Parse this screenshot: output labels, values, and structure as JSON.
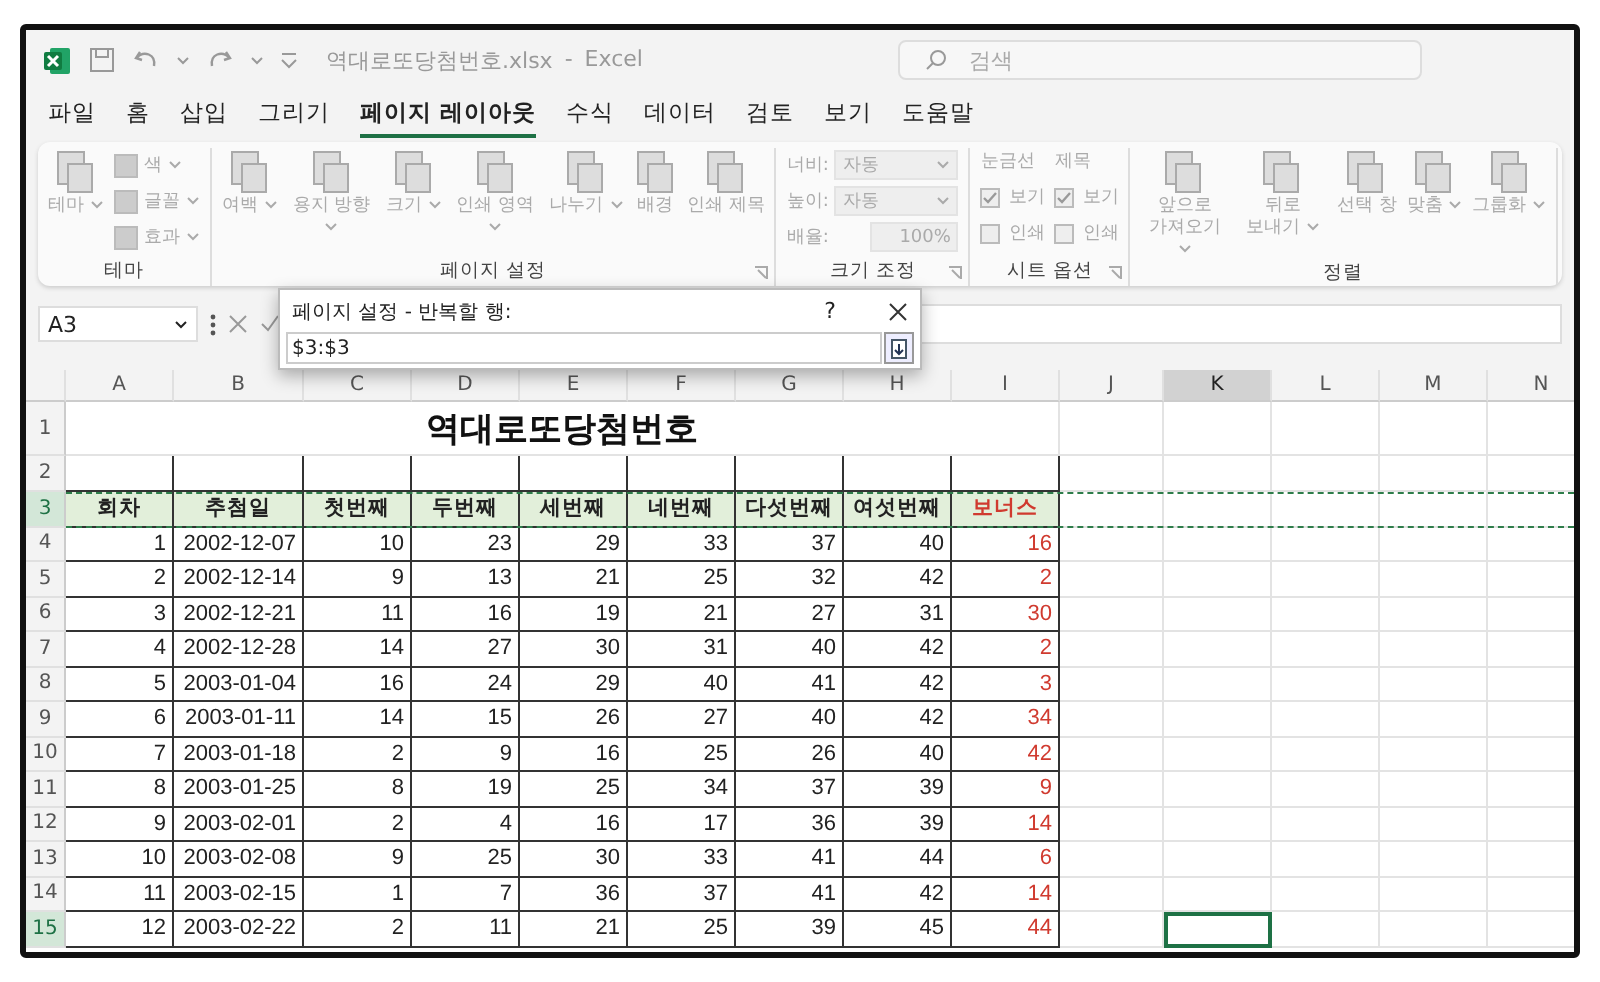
{
  "title_bar": {
    "file_name": "역대로또당첨번호.xlsx",
    "separator": "-",
    "app_name": "Excel",
    "search": {
      "placeholder": "검색"
    }
  },
  "tabs": [
    {
      "label": "파일",
      "selected": false
    },
    {
      "label": "홈",
      "selected": false
    },
    {
      "label": "삽입",
      "selected": false
    },
    {
      "label": "그리기",
      "selected": false
    },
    {
      "label": "페이지 레이아웃",
      "selected": true
    },
    {
      "label": "수식",
      "selected": false
    },
    {
      "label": "데이터",
      "selected": false
    },
    {
      "label": "검토",
      "selected": false
    },
    {
      "label": "보기",
      "selected": false
    },
    {
      "label": "도움말",
      "selected": false
    }
  ],
  "ribbon": {
    "disabled": true,
    "groups": [
      {
        "label": "테마",
        "launcher": false,
        "columns": [
          [
            {
              "kind": "large",
              "label": "테마",
              "dropdown": true
            }
          ],
          [
            {
              "kind": "small",
              "label": "색",
              "dropdown": true
            },
            {
              "kind": "small",
              "label": "글꼴",
              "dropdown": true
            },
            {
              "kind": "small",
              "label": "효과",
              "dropdown": true
            }
          ]
        ]
      },
      {
        "label": "페이지 설정",
        "launcher": true,
        "columns": [
          [
            {
              "kind": "large",
              "label": "여백",
              "dropdown": true
            }
          ],
          [
            {
              "kind": "large",
              "label": "용지 방향",
              "dropdown": true
            }
          ],
          [
            {
              "kind": "large",
              "label": "크기",
              "dropdown": true
            }
          ],
          [
            {
              "kind": "large",
              "label": "인쇄 영역",
              "dropdown": true
            }
          ],
          [
            {
              "kind": "large",
              "label": "나누기",
              "dropdown": true
            }
          ],
          [
            {
              "kind": "large",
              "label": "배경",
              "dropdown": false
            }
          ],
          [
            {
              "kind": "large",
              "label": "인쇄 제목",
              "dropdown": false
            }
          ]
        ]
      },
      {
        "label": "크기 조정",
        "launcher": true,
        "columns": [
          [
            {
              "kind": "field",
              "label": "너비:",
              "value": "자동"
            },
            {
              "kind": "field",
              "label": "높이:",
              "value": "자동"
            },
            {
              "kind": "spinner",
              "label": "배율:",
              "value": "100%"
            }
          ]
        ]
      },
      {
        "label": "시트 옵션",
        "launcher": true,
        "columns": [
          [
            {
              "kind": "heading",
              "label": "눈금선"
            },
            {
              "kind": "check",
              "label": "보기",
              "checked": true
            },
            {
              "kind": "check",
              "label": "인쇄",
              "checked": false
            }
          ],
          [
            {
              "kind": "heading",
              "label": "제목"
            },
            {
              "kind": "check",
              "label": "보기",
              "checked": true
            },
            {
              "kind": "check",
              "label": "인쇄",
              "checked": false
            }
          ]
        ]
      },
      {
        "label": "정렬",
        "launcher": false,
        "columns": [
          [
            {
              "kind": "large",
              "label": "앞으로 가져오기",
              "dropdown": true
            }
          ],
          [
            {
              "kind": "large",
              "label": "뒤로 보내기",
              "dropdown": true
            }
          ],
          [
            {
              "kind": "large",
              "label": "선택 창",
              "dropdown": false
            }
          ],
          [
            {
              "kind": "large",
              "label": "맞춤",
              "dropdown": true
            }
          ],
          [
            {
              "kind": "large",
              "label": "그룹화",
              "dropdown": true
            }
          ]
        ]
      }
    ]
  },
  "formula_bar": {
    "name_box": "A3"
  },
  "dialog": {
    "title": "페이지 설정 - 반복할 행:",
    "help": "?",
    "value": "$3:$3"
  },
  "sheet": {
    "columns": [
      {
        "letter": "A",
        "selected": false
      },
      {
        "letter": "B",
        "selected": false
      },
      {
        "letter": "C",
        "selected": false
      },
      {
        "letter": "D",
        "selected": false
      },
      {
        "letter": "E",
        "selected": false
      },
      {
        "letter": "F",
        "selected": false
      },
      {
        "letter": "G",
        "selected": false
      },
      {
        "letter": "H",
        "selected": false
      },
      {
        "letter": "I",
        "selected": false,
        "color": "#d03a2f"
      },
      {
        "letter": "J",
        "selected": false
      },
      {
        "letter": "K",
        "selected": true
      },
      {
        "letter": "L",
        "selected": false
      },
      {
        "letter": "M",
        "selected": false
      },
      {
        "letter": "N",
        "selected": false
      }
    ],
    "rows": [
      {
        "number": "1",
        "kind": "title",
        "selected": false,
        "text": "역대로또당첨번호"
      },
      {
        "number": "2",
        "kind": "blank",
        "selected": false
      },
      {
        "number": "3",
        "kind": "header",
        "selected": true,
        "marquee": true,
        "cells": [
          "회차",
          "추첨일",
          "첫번째",
          "두번째",
          "세번째",
          "네번째",
          "다섯번째",
          "여섯번째",
          "보너스"
        ]
      },
      {
        "number": "4",
        "kind": "data",
        "selected": false,
        "cells": [
          "1",
          "2002-12-07",
          "10",
          "23",
          "29",
          "33",
          "37",
          "40",
          "16"
        ]
      },
      {
        "number": "5",
        "kind": "data",
        "selected": false,
        "cells": [
          "2",
          "2002-12-14",
          "9",
          "13",
          "21",
          "25",
          "32",
          "42",
          "2"
        ]
      },
      {
        "number": "6",
        "kind": "data",
        "selected": false,
        "cells": [
          "3",
          "2002-12-21",
          "11",
          "16",
          "19",
          "21",
          "27",
          "31",
          "30"
        ]
      },
      {
        "number": "7",
        "kind": "data",
        "selected": false,
        "cells": [
          "4",
          "2002-12-28",
          "14",
          "27",
          "30",
          "31",
          "40",
          "42",
          "2"
        ]
      },
      {
        "number": "8",
        "kind": "data",
        "selected": false,
        "cells": [
          "5",
          "2003-01-04",
          "16",
          "24",
          "29",
          "40",
          "41",
          "42",
          "3"
        ]
      },
      {
        "number": "9",
        "kind": "data",
        "selected": false,
        "cells": [
          "6",
          "2003-01-11",
          "14",
          "15",
          "26",
          "27",
          "40",
          "42",
          "34"
        ]
      },
      {
        "number": "10",
        "kind": "data",
        "selected": false,
        "cells": [
          "7",
          "2003-01-18",
          "2",
          "9",
          "16",
          "25",
          "26",
          "40",
          "42"
        ]
      },
      {
        "number": "11",
        "kind": "data",
        "selected": false,
        "cells": [
          "8",
          "2003-01-25",
          "8",
          "19",
          "25",
          "34",
          "37",
          "39",
          "9"
        ]
      },
      {
        "number": "12",
        "kind": "data",
        "selected": false,
        "cells": [
          "9",
          "2003-02-01",
          "2",
          "4",
          "16",
          "17",
          "36",
          "39",
          "14"
        ]
      },
      {
        "number": "13",
        "kind": "data",
        "selected": false,
        "cells": [
          "10",
          "2003-02-08",
          "9",
          "25",
          "30",
          "33",
          "41",
          "44",
          "6"
        ]
      },
      {
        "number": "14",
        "kind": "data",
        "selected": false,
        "cells": [
          "11",
          "2003-02-15",
          "1",
          "7",
          "36",
          "37",
          "41",
          "42",
          "14"
        ]
      },
      {
        "number": "15",
        "kind": "data",
        "selected": true,
        "cells": [
          "12",
          "2003-02-22",
          "2",
          "11",
          "21",
          "25",
          "39",
          "45",
          "44"
        ]
      }
    ]
  }
}
